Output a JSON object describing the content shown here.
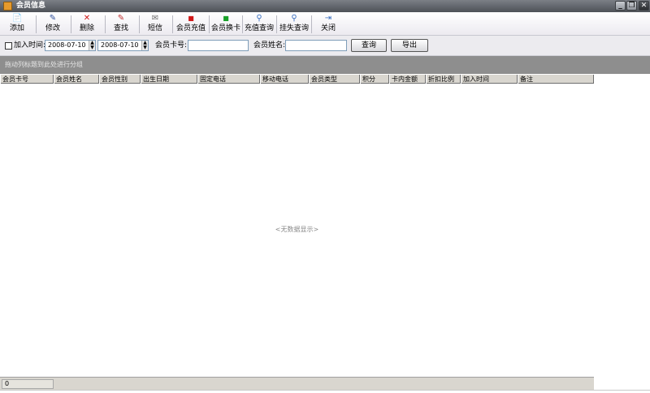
{
  "window": {
    "title": "会员信息",
    "min_label": "_",
    "max_label": "❐",
    "close_label": "✕"
  },
  "toolbar": {
    "items": [
      {
        "label": "添加",
        "icon": "📄",
        "color": "#5a78b8"
      },
      {
        "label": "修改",
        "icon": "✎",
        "color": "#2d4f9a"
      },
      {
        "label": "删除",
        "icon": "✕",
        "color": "#d01818"
      },
      {
        "label": "查找",
        "icon": "✎",
        "color": "#c03030"
      },
      {
        "label": "短信",
        "icon": "✉",
        "color": "#707070"
      },
      {
        "label": "会员充值",
        "icon": "■",
        "color": "#d01818"
      },
      {
        "label": "会员换卡",
        "icon": "■",
        "color": "#18a028"
      },
      {
        "label": "充值查询",
        "icon": "⚲",
        "color": "#3a6fc0"
      },
      {
        "label": "挂失查询",
        "icon": "⚲",
        "color": "#3a6fc0"
      },
      {
        "label": "关闭",
        "icon": "⇥",
        "color": "#3a6fc0"
      }
    ]
  },
  "filter": {
    "join_time_label": "加入时间:",
    "date_from": "2008-07-10",
    "date_to": "2008-07-10",
    "card_no_label": "会员卡号:",
    "card_no_value": "",
    "name_label": "会员姓名:",
    "name_value": "",
    "query_button": "查询",
    "export_button": "导出"
  },
  "group_panel": {
    "hint": "拖动列标题到此处进行分组"
  },
  "grid": {
    "columns": [
      "会员卡号",
      "会员姓名",
      "会员性别",
      "出生日期",
      "固定电话",
      "移动电话",
      "会员类型",
      "积分",
      "卡内金额",
      "折扣比例",
      "加入时间",
      "备注"
    ],
    "empty_text": "<无数据显示>"
  },
  "footer": {
    "count": "0"
  }
}
